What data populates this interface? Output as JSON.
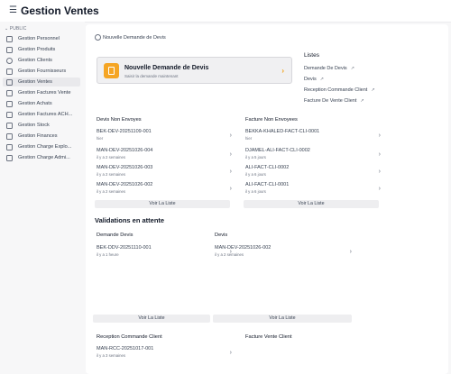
{
  "app": {
    "title": "Gestion Ventes"
  },
  "sidebar": {
    "section": "PUBLIC",
    "items": [
      {
        "label": "Gestion Personnel"
      },
      {
        "label": "Gestion Produits"
      },
      {
        "label": "Gestion Clients"
      },
      {
        "label": "Gestion Fournisseurs"
      },
      {
        "label": "Gestion Ventes",
        "active": true
      },
      {
        "label": "Gestion Factures Vente"
      },
      {
        "label": "Gestion Achats"
      },
      {
        "label": "Gestion Factures ACH..."
      },
      {
        "label": "Gestion Stock"
      },
      {
        "label": "Gestion Finances"
      },
      {
        "label": "Gestion Charge Explo..."
      },
      {
        "label": "Gestion Charge Admi..."
      }
    ]
  },
  "breadcrumb": {
    "label": "Nouvelle Demande de Devis"
  },
  "banner": {
    "title": "Nouvelle Demande de Devis",
    "subtitle": "Saisir la demande maintenant"
  },
  "lists": {
    "title": "Listes",
    "links": [
      {
        "label": "Demande De Devis"
      },
      {
        "label": "Devis"
      },
      {
        "label": "Reception Commande Client"
      },
      {
        "label": "Facture De Vente Client"
      }
    ]
  },
  "devis_non_envoyes": {
    "title": "Devis Non Envoyes",
    "items": [
      {
        "title": "BEK-DEV-20251109-001",
        "time": "hier"
      },
      {
        "title": "MAN-DEV-20251026-004",
        "time": "il y a 2 semaines"
      },
      {
        "title": "MAN-DEV-20251026-003",
        "time": "il y a 2 semaines"
      },
      {
        "title": "MAN-DEV-20251026-002",
        "time": "il y a 2 semaines"
      }
    ],
    "button": "Voir La Liste"
  },
  "facture_non_envoyees": {
    "title": "Facture Non Envoyees",
    "items": [
      {
        "title": "BEKKA-KHALED-FACT-CLI-0001",
        "time": "hier"
      },
      {
        "title": "DJAMEL-ALI-FACT-CLI-0002",
        "time": "il y a 5 jours"
      },
      {
        "title": "ALI-FACT-CLI-0002",
        "time": "il y a 6 jours"
      },
      {
        "title": "ALI-FACT-CLI-0001",
        "time": "il y a 6 jours"
      }
    ],
    "button": "Voir La Liste"
  },
  "validations": {
    "title": "Validations en attente",
    "demande_devis": {
      "title": "Demande Devis",
      "items": [
        {
          "title": "BEK-DDV-20251110-001",
          "time": "il y a 1 heure"
        }
      ],
      "button": "Voir La Liste"
    },
    "devis": {
      "title": "Devis",
      "items": [
        {
          "title": "MAN-DEV-20251026-002",
          "time": "il y a 2 semaines"
        }
      ],
      "button": "Voir La Liste"
    }
  },
  "reception": {
    "title": "Reception Commande Client",
    "items": [
      {
        "title": "MAN-RCC-20251017-001",
        "time": "il y a 3 semaines"
      }
    ]
  },
  "facture_vente_client": {
    "title": "Facture Vente Client"
  }
}
